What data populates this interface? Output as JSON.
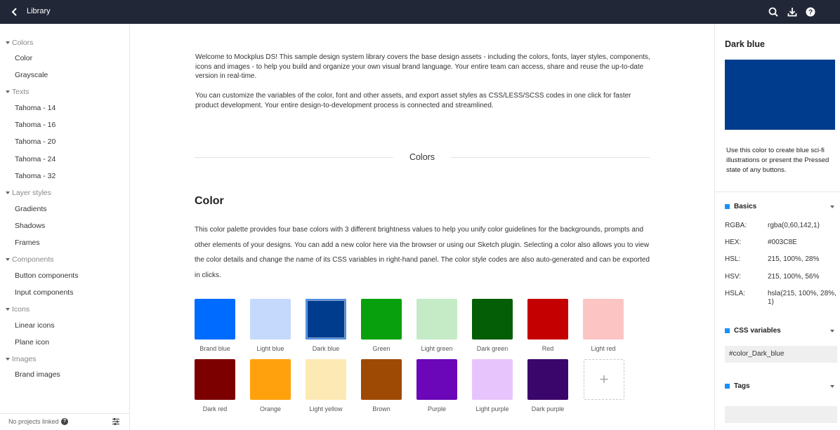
{
  "topbar": {
    "title": "Library",
    "icons": [
      "back-arrow-icon",
      "search-icon",
      "download-icon",
      "help-icon"
    ]
  },
  "sidebar": {
    "groups": [
      {
        "label": "Colors",
        "items": [
          "Color",
          "Grayscale"
        ]
      },
      {
        "label": "Texts",
        "items": [
          "Tahoma - 14",
          "Tahoma - 16",
          "Tahoma - 20",
          "Tahoma - 24",
          "Tahoma - 32"
        ]
      },
      {
        "label": "Layer styles",
        "items": [
          "Gradients",
          "Shadows",
          "Frames"
        ]
      },
      {
        "label": "Components",
        "items": [
          "Button components",
          "Input components"
        ]
      },
      {
        "label": "Icons",
        "items": [
          "Linear icons",
          "Plane icon"
        ]
      },
      {
        "label": "Images",
        "items": [
          "Brand images"
        ]
      }
    ],
    "footer": {
      "text": "No projects linked"
    }
  },
  "main": {
    "intro1": "Welcome to Mockplus DS! This sample design system library covers the base design assets - including the colors, fonts, layer styles, components, icons and images - to help you build and organize your own visual brand language. Your entire team can access, share and reuse the up-to-date version in real-time.",
    "intro2": "You can customize the variables of the color, font and other assets, and export asset styles as CSS/LESS/SCSS codes in one click for faster product development. Your entire design-to-development process is connected and streamlined.",
    "section_label": "Colors",
    "heading": "Color",
    "description": "This color palette provides four base colors with 3 different brightness values to help you unify color guidelines for the backgrounds, prompts and other elements of your designs. You can add a new color here via the browser or using our Sketch plugin. Selecting a color also allows you to view the color details and change the name of its CSS variables in right-hand panel. The color style codes are also auto-generated and can be exported in clicks.",
    "swatches": [
      {
        "name": "Brand blue",
        "color": "#006cff"
      },
      {
        "name": "Light blue",
        "color": "#c5d9fc"
      },
      {
        "name": "Dark blue",
        "color": "#003c8e",
        "selected": true
      },
      {
        "name": "Green",
        "color": "#08a00c"
      },
      {
        "name": "Light green",
        "color": "#c4ebc6"
      },
      {
        "name": "Dark green",
        "color": "#045e05"
      },
      {
        "name": "Red",
        "color": "#c40000"
      },
      {
        "name": "Light red",
        "color": "#fdc4c4"
      },
      {
        "name": "Dark red",
        "color": "#7c0000"
      },
      {
        "name": "Orange",
        "color": "#ffa10c"
      },
      {
        "name": "Light yellow",
        "color": "#fde9b3"
      },
      {
        "name": "Brown",
        "color": "#9e4a05"
      },
      {
        "name": "Purple",
        "color": "#6b07b8"
      },
      {
        "name": "Light purple",
        "color": "#e8c4fc"
      },
      {
        "name": "Dark purple",
        "color": "#3b066c"
      }
    ],
    "add_symbol": "+"
  },
  "right_panel": {
    "title": "Dark blue",
    "preview_color": "#003c8e",
    "description": "Use this color to create blue sci-fi illustrations or present the Pressed state of any buttons.",
    "basics_label": "Basics",
    "basics": [
      {
        "key": "RGBA:",
        "value": "rgba(0,60,142,1)"
      },
      {
        "key": "HEX:",
        "value": "#003C8E"
      },
      {
        "key": "HSL:",
        "value": "215, 100%, 28%"
      },
      {
        "key": "HSV:",
        "value": "215, 100%, 56%"
      },
      {
        "key": "HSLA:",
        "value": "hsla(215, 100%, 28%, 1)"
      }
    ],
    "css_label": "CSS variables",
    "css_value": "#color_Dark_blue",
    "tags_label": "Tags"
  },
  "colors": {
    "topbar": "#212736",
    "accent": "#1890ff"
  }
}
